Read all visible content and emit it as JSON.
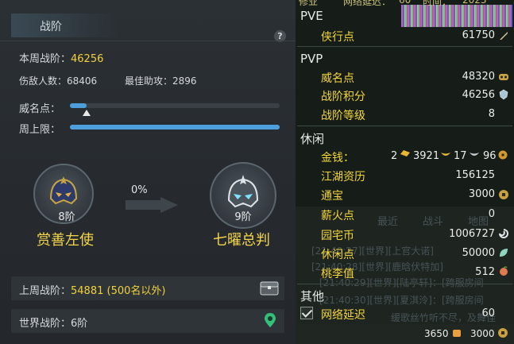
{
  "left": {
    "title": "战阶",
    "help": "?",
    "week_rank_label": "本周战阶：",
    "week_rank_value": "46256",
    "damage_count_label": "伤敌人数：",
    "damage_count_value": "68406",
    "best_assist_label": "最佳助攻：",
    "best_assist_value": "2896",
    "prestige_label": "威名点：",
    "weekly_limit_label": "周上限：",
    "prestige_progress": 0.08,
    "weekly_progress": 1.0,
    "progress_pct": "0%",
    "current_rank": {
      "level": "8阶",
      "name": "赏善左使"
    },
    "next_rank": {
      "level": "9阶",
      "name": "七曜总判"
    },
    "last_week_label": "上周战阶：",
    "last_week_value": "54881 (500名以外)",
    "world_rank_label": "世界战阶：",
    "world_rank_value": "6阶"
  },
  "right": {
    "top_partial": [
      "修业",
      "网络延迟：",
      "60",
      "时间：",
      "2023"
    ],
    "pve": {
      "header": "PVE",
      "rows": [
        {
          "label": "侠行点",
          "value": "61750",
          "icon": "sword-icon"
        }
      ]
    },
    "pvp": {
      "header": "PVP",
      "rows": [
        {
          "label": "威名点",
          "value": "48320",
          "icon": "mask-icon"
        },
        {
          "label": "战阶积分",
          "value": "46256",
          "icon": "crest-icon"
        },
        {
          "label": "战阶等级",
          "value": "8",
          "icon": ""
        }
      ]
    },
    "leisure": {
      "header": "休闲",
      "money_label": "金钱：",
      "money": [
        {
          "value": "2",
          "icon": "gold-ingot-icon"
        },
        {
          "value": "3921",
          "icon": "gold-boat-icon"
        },
        {
          "value": "17",
          "icon": "silver-boat-icon"
        },
        {
          "value": "96",
          "icon": "copper-coin-icon"
        }
      ],
      "rows": [
        {
          "label": "江湖资历",
          "value": "156125",
          "icon": ""
        },
        {
          "label": "通宝",
          "value": "3000",
          "icon": "coin-icon"
        },
        {
          "label": "薪火点",
          "value": "0",
          "icon": ""
        },
        {
          "label": "园宅币",
          "value": "1006727",
          "icon": "swirl-coin-icon"
        },
        {
          "label": "休闲点",
          "value": "50000",
          "icon": "leaf-icon"
        },
        {
          "label": "桃李值",
          "value": "512",
          "icon": "peach-icon"
        }
      ]
    },
    "other": {
      "header": "其他",
      "rows": [
        {
          "label": "网络延迟",
          "value": "60"
        }
      ]
    },
    "chat_bg": {
      "tabs": [
        "最近",
        "战斗",
        "地图"
      ],
      "lines": [
        "[21:40:27][世界][上官大诺]",
        "[21:40:28][世界][鹿晗伏特加]",
        "[21:40:29][世界][陆亭轩]：[跨服房间",
        "[21:40:30][世界][夏淇泠]：[跨服房间",
        "缓歌丝竹听不尽，及舞佳"
      ]
    },
    "bottom": {
      "left_value": "3650",
      "right_value": "3000"
    }
  },
  "colors": {
    "accent_yellow": "#f1d23a",
    "bar_blue": "#4d9fdc",
    "panel": "#262a2e",
    "right_bg": "#161d18"
  }
}
